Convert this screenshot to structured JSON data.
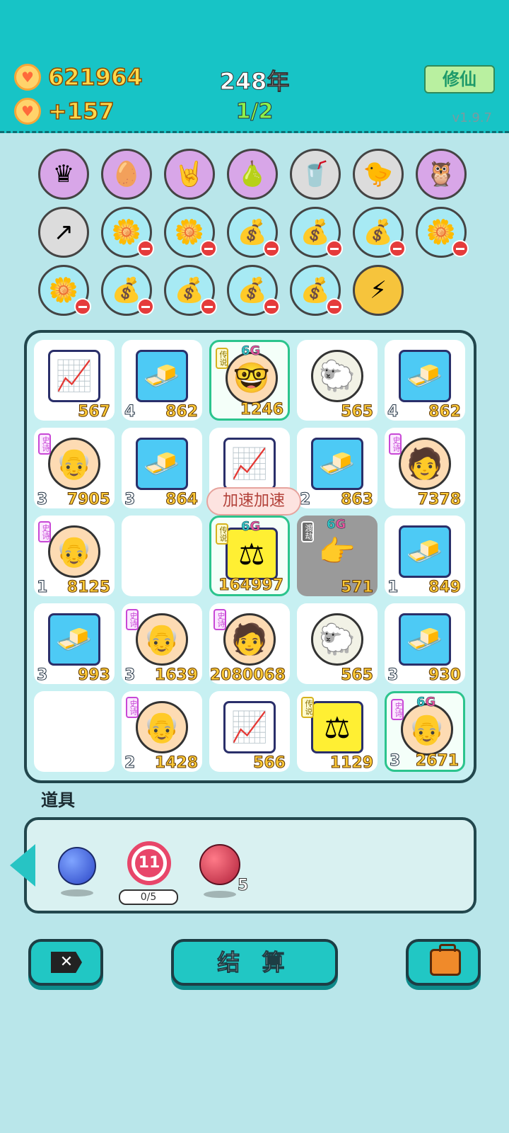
{
  "header": {
    "coins": "621964",
    "income": "+157",
    "year": "248年",
    "round": "1/2",
    "cultivate_label": "修仙",
    "version": "v1.9.7"
  },
  "inventory": [
    [
      {
        "icon": "crown-box-icon",
        "style": "purple",
        "glyph": "♛",
        "remove": false
      },
      {
        "icon": "egg-icon",
        "style": "purple",
        "glyph": "🥚",
        "remove": false
      },
      {
        "icon": "rock-hand-icon",
        "style": "purple",
        "glyph": "🤘",
        "remove": false
      },
      {
        "icon": "pomelo-icon",
        "style": "purple",
        "glyph": "🍐",
        "remove": false
      },
      {
        "icon": "milk-tea-icon",
        "style": "gray",
        "glyph": "🥤",
        "remove": false
      },
      {
        "icon": "chick-egg-icon",
        "style": "gray",
        "glyph": "🐤",
        "remove": false
      },
      {
        "icon": "owl-icon",
        "style": "purple",
        "glyph": "🦉",
        "remove": false
      }
    ],
    [
      {
        "icon": "arrow-card-icon",
        "style": "gray",
        "glyph": "↗",
        "remove": false
      },
      {
        "icon": "flower-pot-icon",
        "style": "blue",
        "glyph": "🌼",
        "remove": true
      },
      {
        "icon": "flower-pot-icon",
        "style": "blue",
        "glyph": "🌼",
        "remove": true
      },
      {
        "icon": "money-bag-icon",
        "style": "blue",
        "glyph": "💰",
        "remove": true
      },
      {
        "icon": "money-bag-icon",
        "style": "blue",
        "glyph": "💰",
        "remove": true
      },
      {
        "icon": "money-bag-icon",
        "style": "blue",
        "glyph": "💰",
        "remove": true
      },
      {
        "icon": "flower-pot-icon",
        "style": "blue",
        "glyph": "🌼",
        "remove": true
      }
    ],
    [
      {
        "icon": "flower-pot-icon",
        "style": "blue",
        "glyph": "🌼",
        "remove": true
      },
      {
        "icon": "money-bag-icon",
        "style": "blue",
        "glyph": "💰",
        "remove": true
      },
      {
        "icon": "money-bag-icon",
        "style": "blue",
        "glyph": "💰",
        "remove": true
      },
      {
        "icon": "money-bag-icon",
        "style": "blue",
        "glyph": "💰",
        "remove": true
      },
      {
        "icon": "money-bag-icon",
        "style": "blue",
        "glyph": "💰",
        "remove": true
      },
      {
        "icon": "lightning-icon",
        "style": "gold",
        "glyph": "⚡",
        "remove": false
      }
    ]
  ],
  "board": [
    {
      "kind": "chart",
      "value": "567",
      "level": "",
      "tag": "",
      "badge": false,
      "legend": false
    },
    {
      "kind": "gold",
      "value": "862",
      "level": "4",
      "tag": "",
      "badge": false,
      "legend": false
    },
    {
      "kind": "face-glasses",
      "value": "1246",
      "level": "",
      "tag": "传说",
      "badge": true,
      "legend": true
    },
    {
      "kind": "sheep",
      "value": "565",
      "level": "",
      "tag": "",
      "badge": false,
      "legend": false
    },
    {
      "kind": "gold",
      "value": "862",
      "level": "4",
      "tag": "",
      "badge": false,
      "legend": false
    },
    {
      "kind": "old-man",
      "value": "7905",
      "level": "3",
      "tag": "史诗",
      "badge": false,
      "legend": false
    },
    {
      "kind": "gold",
      "value": "864",
      "level": "3",
      "tag": "",
      "badge": false,
      "legend": false
    },
    {
      "kind": "chart",
      "value": "",
      "level": "",
      "tag": "",
      "badge": false,
      "legend": false
    },
    {
      "kind": "gold",
      "value": "863",
      "level": "2",
      "tag": "",
      "badge": false,
      "legend": false
    },
    {
      "kind": "green-hat",
      "value": "7378",
      "level": "",
      "tag": "史诗",
      "badge": false,
      "legend": false
    },
    {
      "kind": "old-man",
      "value": "8125",
      "level": "1",
      "tag": "史诗",
      "badge": false,
      "legend": false
    },
    {
      "kind": "empty",
      "value": "",
      "level": "",
      "tag": "",
      "badge": false,
      "legend": false
    },
    {
      "kind": "scale",
      "value": "164997",
      "level": "",
      "tag": "传说",
      "badge": true,
      "legend": true
    },
    {
      "kind": "pointer",
      "value": "571",
      "level": "",
      "tag": "渡劫",
      "badge": true,
      "legend": false,
      "dark": true
    },
    {
      "kind": "gold",
      "value": "849",
      "level": "1",
      "tag": "",
      "badge": false,
      "legend": false
    },
    {
      "kind": "gold",
      "value": "993",
      "level": "3",
      "tag": "",
      "badge": false,
      "legend": false
    },
    {
      "kind": "old-man",
      "value": "1639",
      "level": "3",
      "tag": "史诗",
      "badge": false,
      "legend": false
    },
    {
      "kind": "green-hat",
      "value": "2080068",
      "level": "",
      "tag": "史诗",
      "badge": false,
      "legend": false
    },
    {
      "kind": "sheep",
      "value": "565",
      "level": "",
      "tag": "",
      "badge": false,
      "legend": false
    },
    {
      "kind": "gold",
      "value": "930",
      "level": "3",
      "tag": "",
      "badge": false,
      "legend": false
    },
    {
      "kind": "empty",
      "value": "",
      "level": "",
      "tag": "",
      "badge": false,
      "legend": false
    },
    {
      "kind": "old-man",
      "value": "1428",
      "level": "2",
      "tag": "史诗",
      "badge": false,
      "legend": false
    },
    {
      "kind": "chart",
      "value": "566",
      "level": "",
      "tag": "",
      "badge": false,
      "legend": false
    },
    {
      "kind": "scale",
      "value": "1129",
      "level": "",
      "tag": "传说",
      "badge": false,
      "legend": false
    },
    {
      "kind": "old-man",
      "value": "2671",
      "level": "3",
      "tag": "史诗",
      "badge": true,
      "legend": true
    }
  ],
  "badge_label": {
    "num": "6",
    "g": "G"
  },
  "speed_bubble": "加速加速",
  "props": {
    "label": "道具",
    "target_value": "11",
    "target_count": "0/5",
    "lychee_count": "5"
  },
  "buttons": {
    "settle_label": "结 算"
  }
}
